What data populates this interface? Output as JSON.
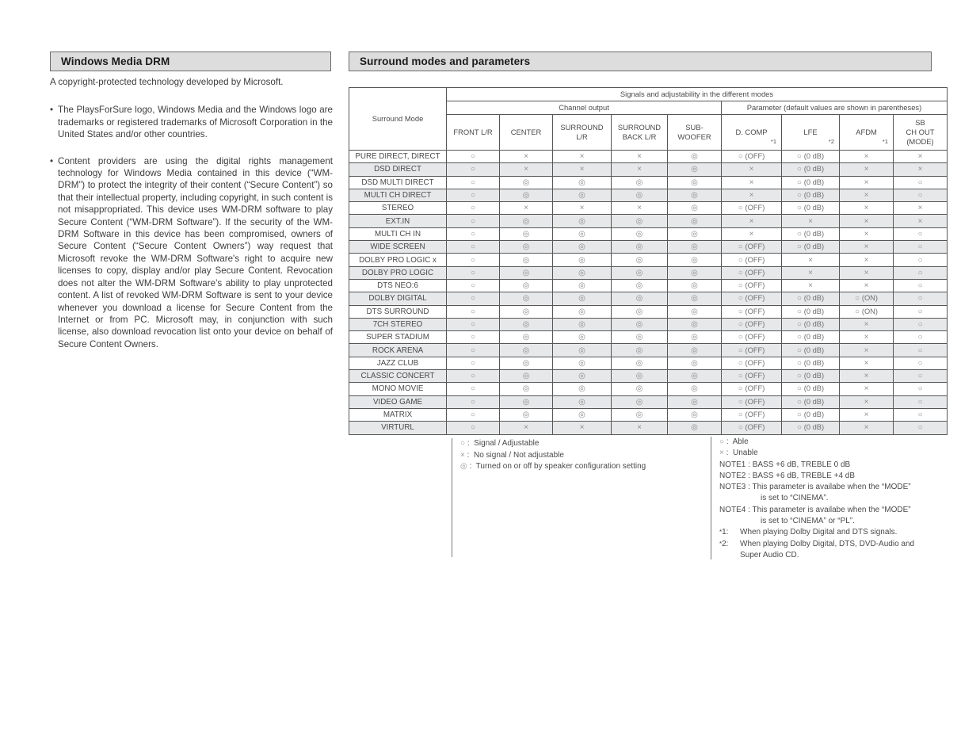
{
  "left_section": {
    "heading": "Windows Media DRM",
    "lead": "A copyright-protected technology developed by Microsoft.",
    "bullets": [
      "The PlaysForSure logo, Windows Media and the Windows logo are trademarks or registered trademarks of Microsoft Corporation in the United States and/or other countries.",
      "Content providers are using the digital rights management technology for Windows Media contained in this device (“WM-DRM”) to protect the integrity of their content (“Secure Content”) so that their intellectual property, including copyright, in such content is not misappropriated. This device uses WM-DRM software to play Secure Content (“WM-DRM Software”). If the security of the WM-DRM Software in this device has been compromised, owners of Secure Content (“Secure Content Owners”) way request that Microsoft revoke the WM-DRM Software's right to acquire new licenses to copy, display and/or play Secure Content. Revocation does not alter the WM-DRM Software’s ability to play unprotected content. A list of revoked WM-DRM Software is sent to your device whenever you download a license for Secure Content from the Internet or from PC. Microsoft may, in conjunction with such license, also download revocation list onto your device on behalf of Secure Content Owners."
    ],
    "bullet_marker": "•"
  },
  "right_section": {
    "heading": "Surround modes and parameters"
  },
  "table": {
    "mode_header": "Surround Mode",
    "group_top": "Signals and adjustability in the different modes",
    "group_channel": "Channel output",
    "group_parameter": "Parameter (default values are shown in parentheses)",
    "columns": [
      {
        "label": "FRONT L/R",
        "note": ""
      },
      {
        "label": "CENTER",
        "note": ""
      },
      {
        "label": "SURROUND L/R",
        "note": ""
      },
      {
        "label": "SURROUND BACK L/R",
        "note": ""
      },
      {
        "label": "SUB- WOOFER",
        "note": ""
      },
      {
        "label": "D. COMP",
        "note": "*1"
      },
      {
        "label": "LFE",
        "note": "*2"
      },
      {
        "label": "AFDM",
        "note": "*1"
      },
      {
        "label": "SB CH OUT (MODE)",
        "note": ""
      }
    ],
    "symbols": {
      "able": "○",
      "unable": "×",
      "speaker": "◎"
    },
    "rows": [
      {
        "mode": "PURE DIRECT, DIRECT",
        "cells": [
          "O",
          "X",
          "X",
          "X",
          "D",
          "O (OFF)",
          "O (0 dB)",
          "X",
          "X"
        ]
      },
      {
        "mode": "DSD DIRECT",
        "cells": [
          "O",
          "X",
          "X",
          "X",
          "D",
          "X",
          "O (0 dB)",
          "X",
          "X"
        ]
      },
      {
        "mode": "DSD MULTI DIRECT",
        "cells": [
          "O",
          "D",
          "D",
          "D",
          "D",
          "X",
          "O (0 dB)",
          "X",
          "O"
        ]
      },
      {
        "mode": "MULTI CH DIRECT",
        "cells": [
          "O",
          "D",
          "D",
          "D",
          "D",
          "X",
          "O (0 dB)",
          "X",
          "O"
        ]
      },
      {
        "mode": "STEREO",
        "cells": [
          "O",
          "X",
          "X",
          "X",
          "D",
          "O (OFF)",
          "O (0 dB)",
          "X",
          "X"
        ]
      },
      {
        "mode": "EXT.IN",
        "cells": [
          "O",
          "D",
          "D",
          "D",
          "D",
          "X",
          "X",
          "X",
          "X"
        ]
      },
      {
        "mode": "MULTI CH IN",
        "cells": [
          "O",
          "D",
          "D",
          "D",
          "D",
          "X",
          "O (0 dB)",
          "X",
          "O"
        ]
      },
      {
        "mode": "WIDE SCREEN",
        "cells": [
          "O",
          "D",
          "D",
          "D",
          "D",
          "O (OFF)",
          "O (0 dB)",
          "X",
          "O"
        ]
      },
      {
        "mode": "DOLBY PRO LOGIC  x",
        "cells": [
          "O",
          "D",
          "D",
          "D",
          "D",
          "O (OFF)",
          "X",
          "X",
          "O"
        ]
      },
      {
        "mode": "DOLBY PRO LOGIC",
        "cells": [
          "O",
          "D",
          "D",
          "D",
          "D",
          "O (OFF)",
          "X",
          "X",
          "O"
        ]
      },
      {
        "mode": "DTS NEO:6",
        "cells": [
          "O",
          "D",
          "D",
          "D",
          "D",
          "O (OFF)",
          "X",
          "X",
          "O"
        ]
      },
      {
        "mode": "DOLBY DIGITAL",
        "cells": [
          "O",
          "D",
          "D",
          "D",
          "D",
          "O (OFF)",
          "O (0 dB)",
          "O (ON)",
          "O"
        ]
      },
      {
        "mode": "DTS SURROUND",
        "cells": [
          "O",
          "D",
          "D",
          "D",
          "D",
          "O (OFF)",
          "O (0 dB)",
          "O (ON)",
          "O"
        ]
      },
      {
        "mode": "7CH STEREO",
        "cells": [
          "O",
          "D",
          "D",
          "D",
          "D",
          "O (OFF)",
          "O (0 dB)",
          "X",
          "O"
        ]
      },
      {
        "mode": "SUPER STADIUM",
        "cells": [
          "O",
          "D",
          "D",
          "D",
          "D",
          "O (OFF)",
          "O (0 dB)",
          "X",
          "O"
        ]
      },
      {
        "mode": "ROCK ARENA",
        "cells": [
          "O",
          "D",
          "D",
          "D",
          "D",
          "O (OFF)",
          "O (0 dB)",
          "X",
          "O"
        ]
      },
      {
        "mode": "JAZZ CLUB",
        "cells": [
          "O",
          "D",
          "D",
          "D",
          "D",
          "O (OFF)",
          "O (0 dB)",
          "X",
          "O"
        ]
      },
      {
        "mode": "CLASSIC CONCERT",
        "cells": [
          "O",
          "D",
          "D",
          "D",
          "D",
          "O (OFF)",
          "O (0 dB)",
          "X",
          "O"
        ]
      },
      {
        "mode": "MONO MOVIE",
        "cells": [
          "O",
          "D",
          "D",
          "D",
          "D",
          "O (OFF)",
          "O (0 dB)",
          "X",
          "O"
        ]
      },
      {
        "mode": "VIDEO GAME",
        "cells": [
          "O",
          "D",
          "D",
          "D",
          "D",
          "O (OFF)",
          "O (0 dB)",
          "X",
          "O"
        ]
      },
      {
        "mode": "MATRIX",
        "cells": [
          "O",
          "D",
          "D",
          "D",
          "D",
          "O (OFF)",
          "O (0 dB)",
          "X",
          "O"
        ]
      },
      {
        "mode": "VIRTURL",
        "cells": [
          "O",
          "X",
          "X",
          "X",
          "D",
          "O (OFF)",
          "O (0 dB)",
          "X",
          "O"
        ]
      }
    ]
  },
  "legend_left": {
    "items": [
      {
        "sym": "○",
        "sep": ":",
        "text": "Signal / Adjustable"
      },
      {
        "sym": "×",
        "sep": ":",
        "text": "No signal / Not adjustable"
      },
      {
        "sym": "◎",
        "sep": ":",
        "text": "Turned on or off by speaker configuration setting"
      }
    ]
  },
  "legend_right": {
    "items": [
      {
        "sym": "○",
        "sep": ":",
        "text": "Able"
      },
      {
        "sym": "×",
        "sep": ":",
        "text": "Unable"
      }
    ],
    "notes": [
      {
        "key": "NOTE1 :",
        "text": "BASS +6 dB, TREBLE 0 dB",
        "cont": ""
      },
      {
        "key": "NOTE2 :",
        "text": "BASS +6 dB, TREBLE +4 dB",
        "cont": ""
      },
      {
        "key": "NOTE3 :",
        "text": "This parameter is availabe when the “MODE”",
        "cont": "is set to “CINEMA”."
      },
      {
        "key": "NOTE4 :",
        "text": "This parameter is availabe when the “MODE”",
        "cont": "is set to “CINEMA” or “PL”."
      }
    ],
    "footnotes": [
      {
        "mark": "*1:",
        "text": "When playing Dolby Digital and DTS signals.",
        "cont": ""
      },
      {
        "mark": "*2:",
        "text": "When playing Dolby Digital, DTS, DVD-Audio and",
        "cont": "Super Audio CD."
      }
    ]
  }
}
